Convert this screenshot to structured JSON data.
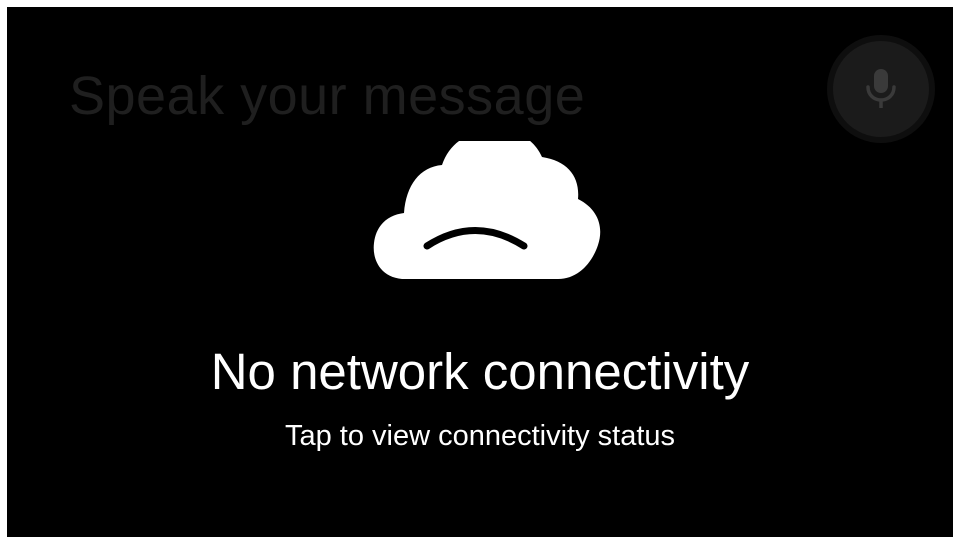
{
  "voice_input": {
    "prompt": "Speak your message",
    "mic_icon": "microphone-icon"
  },
  "error": {
    "icon": "sad-cloud-icon",
    "title": "No network connectivity",
    "subtitle": "Tap to view connectivity status"
  },
  "colors": {
    "background": "#000000",
    "text": "#ffffff",
    "prompt_text": "#1f1f1f",
    "mic_button": "#1b1b1b",
    "mic_icon": "#3a3a3a"
  }
}
